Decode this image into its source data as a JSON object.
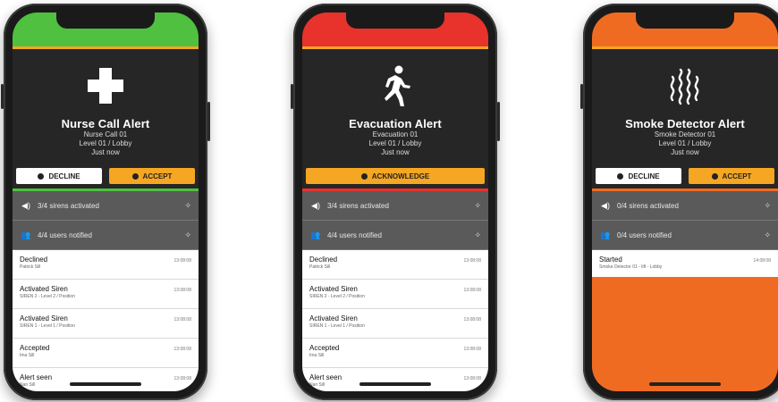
{
  "colors": {
    "green": "#4fc03f",
    "red": "#e8322c",
    "orange": "#f06b22",
    "accent": "#f5a623",
    "panel": "#262626",
    "status_bg": "#5a5a5a"
  },
  "phones": [
    {
      "icon": "medical-cross-icon",
      "title": "Nurse Call Alert",
      "source": "Nurse Call 01",
      "location": "Level 01 / Lobby",
      "time": "Just now",
      "decline_label": "DECLINE",
      "accept_label": "ACCEPT",
      "status": [
        {
          "icon": "speaker-icon",
          "label": "3/4 sirens activated"
        },
        {
          "icon": "users-icon",
          "label": "4/4 users notified"
        }
      ],
      "log": [
        {
          "title": "Declined",
          "sub": "Patrick Sill",
          "time": "13:08:08"
        },
        {
          "title": "Activated Siren",
          "sub": "SIREN 2 - Level 2 / Position",
          "time": "13:08:08"
        },
        {
          "title": "Activated Siren",
          "sub": "SIREN 1 - Level 1 / Position",
          "time": "13:08:08"
        },
        {
          "title": "Accepted",
          "sub": "Ima Sill",
          "time": "13:08:08"
        },
        {
          "title": "Alert seen",
          "sub": "Nan Sill",
          "time": "13:08:08"
        }
      ]
    },
    {
      "icon": "running-person-icon",
      "title": "Evacuation Alert",
      "source": "Evacuation 01",
      "location": "Level 01 / Lobby",
      "time": "Just now",
      "ack_label": "ACKNOWLEDGE",
      "status": [
        {
          "icon": "speaker-icon",
          "label": "3/4 sirens activated"
        },
        {
          "icon": "users-icon",
          "label": "4/4 users notified"
        }
      ],
      "log": [
        {
          "title": "Declined",
          "sub": "Patrick Sill",
          "time": "13:08:08"
        },
        {
          "title": "Activated Siren",
          "sub": "SIREN 2 - Level 2 / Position",
          "time": "13:08:08"
        },
        {
          "title": "Activated Siren",
          "sub": "SIREN 1 - Level 1 / Position",
          "time": "13:08:08"
        },
        {
          "title": "Accepted",
          "sub": "Ima Sill",
          "time": "13:08:08"
        },
        {
          "title": "Alert seen",
          "sub": "Nan Sill",
          "time": "13:08:08"
        }
      ]
    },
    {
      "icon": "smoke-icon",
      "title": "Smoke Detector Alert",
      "source": "Smoke Detector 01",
      "location": "Level 01 / Lobby",
      "time": "Just now",
      "decline_label": "DECLINE",
      "accept_label": "ACCEPT",
      "status": [
        {
          "icon": "speaker-icon",
          "label": "0/4 sirens activated"
        },
        {
          "icon": "users-icon",
          "label": "0/4 users notified"
        }
      ],
      "log": [
        {
          "title": "Started",
          "sub": "Smoke Detector 01 - lift - Lobby",
          "time": "14:08:08"
        }
      ]
    }
  ]
}
